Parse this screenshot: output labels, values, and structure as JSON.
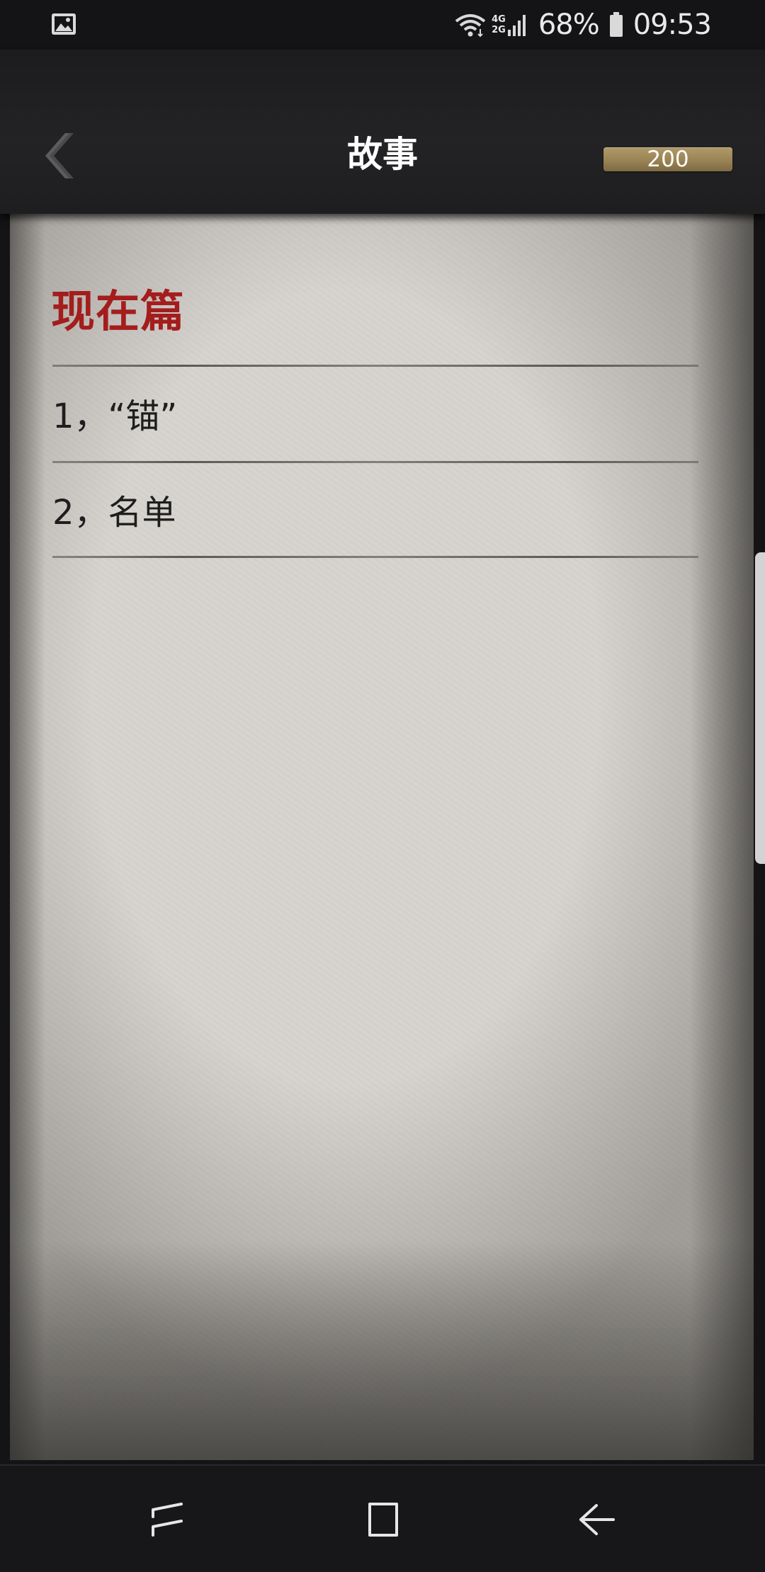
{
  "status_bar": {
    "network_top": "4G",
    "network_bottom": "2G",
    "battery_percent": "68%",
    "time": "09:53",
    "icons": [
      "gallery-icon",
      "wifi-icon",
      "signal-icon",
      "battery-icon"
    ]
  },
  "header": {
    "back_icon": "chevron-left-icon",
    "title": "故事",
    "coin_count": "200",
    "coin_color": "#9a8354"
  },
  "content": {
    "section_title": "现在篇",
    "section_title_color": "#a41d1d",
    "items": [
      {
        "label": "1，“锚”"
      },
      {
        "label": "2，名单"
      }
    ]
  },
  "nav_bar": {
    "icons": [
      "recent-apps-icon",
      "home-icon",
      "back-icon"
    ]
  }
}
